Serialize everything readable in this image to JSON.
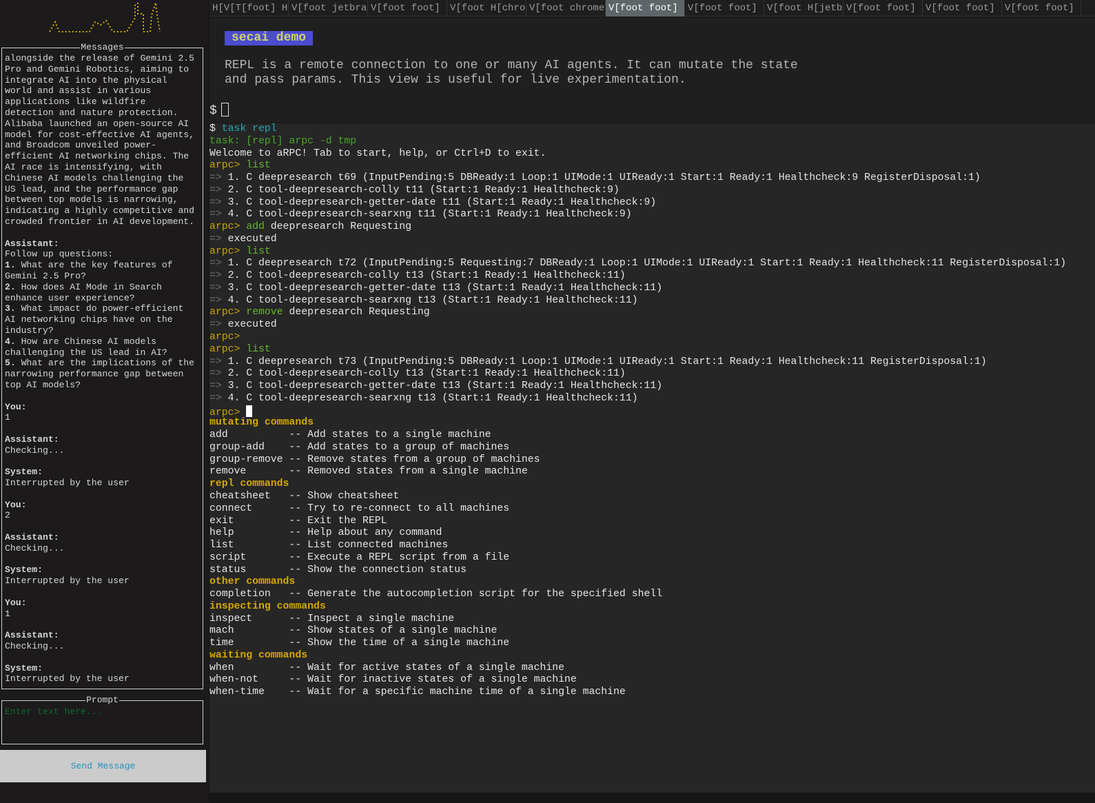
{
  "colors": {
    "accent_badge": "#4c4cd0",
    "prompt_yellow": "#c8a400",
    "command_green": "#62b82c",
    "header_yellow": "#d4a800",
    "send_text": "#2a8fc0"
  },
  "left": {
    "messages_title": "Messages",
    "messages": [
      {
        "role": "",
        "lines": [
          "alongside the release of Gemini 2.5",
          "Pro and Gemini Robotics, aiming to",
          "integrate AI into the physical",
          "world and assist in various",
          "applications like wildfire",
          "detection and nature protection.",
          "Alibaba launched an open-source AI",
          "model for cost-effective AI agents,",
          "and Broadcom unveiled power-",
          "efficient AI networking chips. The",
          "AI race is intensifying, with",
          "Chinese AI models challenging the",
          "US lead, and the performance gap",
          "between top models is narrowing,",
          "indicating a highly competitive and",
          "crowded frontier in AI development."
        ]
      },
      {
        "role": "Assistant",
        "lines": [
          "Follow up questions:",
          "1. What are the key features of",
          "Gemini 2.5 Pro?",
          "2. How does AI Mode in Search",
          "enhance user experience?",
          "3. What impact do power-efficient",
          "AI networking chips have on the",
          "industry?",
          "4. How are Chinese AI models",
          "challenging the US lead in AI?",
          "5. What are the implications of the",
          "narrowing performance gap between",
          "top AI models?"
        ]
      },
      {
        "role": "You",
        "lines": [
          "1"
        ]
      },
      {
        "role": "Assistant",
        "lines": [
          "Checking..."
        ]
      },
      {
        "role": "System",
        "lines": [
          "Interrupted by the user"
        ]
      },
      {
        "role": "You",
        "lines": [
          "2"
        ]
      },
      {
        "role": "Assistant",
        "lines": [
          "Checking..."
        ]
      },
      {
        "role": "System",
        "lines": [
          "Interrupted by the user"
        ]
      },
      {
        "role": "You",
        "lines": [
          "1"
        ]
      },
      {
        "role": "Assistant",
        "lines": [
          "Checking..."
        ]
      },
      {
        "role": "System",
        "lines": [
          "Interrupted by the user"
        ]
      }
    ],
    "prompt_title": "Prompt",
    "prompt_placeholder": "Enter text here...",
    "send_label": "Send Message"
  },
  "tabs": [
    {
      "label": "H[V[T[foot] H",
      "active": false
    },
    {
      "label": "V[foot jetbra:",
      "active": false
    },
    {
      "label": "V[foot foot]",
      "active": false
    },
    {
      "label": "V[foot H[chrom",
      "active": false
    },
    {
      "label": "V[foot chrome",
      "active": false
    },
    {
      "label": "V[foot foot]",
      "active": true
    },
    {
      "label": "V[foot foot]",
      "active": false
    },
    {
      "label": "V[foot H[jetb:",
      "active": false
    },
    {
      "label": "V[foot foot]",
      "active": false
    },
    {
      "label": "V[foot foot]",
      "active": false
    },
    {
      "label": "V[foot foot]",
      "active": false
    }
  ],
  "top": {
    "badge": "secai demo",
    "description": "REPL is a remote connection to one or many AI agents. It can mutate the state\nand pass params. This view is useful for live experimentation.",
    "shell_prompt": "$"
  },
  "terminal": [
    [
      [
        "w",
        "$ "
      ],
      [
        "c",
        "task repl"
      ]
    ],
    [
      [
        "g",
        "task: [repl] arpc -d tmp"
      ]
    ],
    [
      [
        "w",
        "Welcome to aRPC! Tab to start, help, or Ctrl+D to exit."
      ]
    ],
    [
      [
        "y",
        "arpc> "
      ],
      [
        "gl",
        "list"
      ]
    ],
    [
      [
        "d",
        "=> "
      ],
      [
        "w",
        "1. C deepresearch t69 (InputPending:5 DBReady:1 Loop:1 UIMode:1 UIReady:1 Start:1 Ready:1 Healthcheck:9 RegisterDisposal:1)"
      ]
    ],
    [
      [
        "d",
        "=> "
      ],
      [
        "w",
        "2. C tool-deepresearch-colly t11 (Start:1 Ready:1 Healthcheck:9)"
      ]
    ],
    [
      [
        "d",
        "=> "
      ],
      [
        "w",
        "3. C tool-deepresearch-getter-date t11 (Start:1 Ready:1 Healthcheck:9)"
      ]
    ],
    [
      [
        "d",
        "=> "
      ],
      [
        "w",
        "4. C tool-deepresearch-searxng t11 (Start:1 Ready:1 Healthcheck:9)"
      ]
    ],
    [
      [
        "y",
        "arpc> "
      ],
      [
        "gl",
        "add"
      ],
      [
        "w",
        " deepresearch Requesting"
      ]
    ],
    [
      [
        "d",
        "=> "
      ],
      [
        "w",
        "executed"
      ]
    ],
    [
      [
        "y",
        "arpc> "
      ],
      [
        "gl",
        "list"
      ]
    ],
    [
      [
        "d",
        "=> "
      ],
      [
        "w",
        "1. C deepresearch t72 (InputPending:5 Requesting:7 DBReady:1 Loop:1 UIMode:1 UIReady:1 Start:1 Ready:1 Healthcheck:11 RegisterDisposal:1)"
      ]
    ],
    [
      [
        "d",
        "=> "
      ],
      [
        "w",
        "2. C tool-deepresearch-colly t13 (Start:1 Ready:1 Healthcheck:11)"
      ]
    ],
    [
      [
        "d",
        "=> "
      ],
      [
        "w",
        "3. C tool-deepresearch-getter-date t13 (Start:1 Ready:1 Healthcheck:11)"
      ]
    ],
    [
      [
        "d",
        "=> "
      ],
      [
        "w",
        "4. C tool-deepresearch-searxng t13 (Start:1 Ready:1 Healthcheck:11)"
      ]
    ],
    [
      [
        "y",
        "arpc> "
      ],
      [
        "gl",
        "remove"
      ],
      [
        "w",
        " deepresearch Requesting"
      ]
    ],
    [
      [
        "d",
        "=> "
      ],
      [
        "w",
        "executed"
      ]
    ],
    [
      [
        "y",
        "arpc>"
      ]
    ],
    [
      [
        "y",
        "arpc> "
      ],
      [
        "gl",
        "list"
      ]
    ],
    [
      [
        "d",
        "=> "
      ],
      [
        "w",
        "1. C deepresearch t73 (InputPending:5 DBReady:1 Loop:1 UIMode:1 UIReady:1 Start:1 Ready:1 Healthcheck:11 RegisterDisposal:1)"
      ]
    ],
    [
      [
        "d",
        "=> "
      ],
      [
        "w",
        "2. C tool-deepresearch-colly t13 (Start:1 Ready:1 Healthcheck:11)"
      ]
    ],
    [
      [
        "d",
        "=> "
      ],
      [
        "w",
        "3. C tool-deepresearch-getter-date t13 (Start:1 Ready:1 Healthcheck:11)"
      ]
    ],
    [
      [
        "d",
        "=> "
      ],
      [
        "w",
        "4. C tool-deepresearch-searxng t13 (Start:1 Ready:1 Healthcheck:11)"
      ]
    ],
    [
      [
        "y",
        "arpc> "
      ],
      [
        "cursor",
        ""
      ]
    ],
    [
      [
        "h",
        "mutating commands"
      ]
    ],
    [
      [
        "w",
        "add          -- Add states to a single machine"
      ]
    ],
    [
      [
        "w",
        "group-add    -- Add states to a group of machines"
      ]
    ],
    [
      [
        "w",
        "group-remove -- Remove states from a group of machines"
      ]
    ],
    [
      [
        "w",
        "remove       -- Removed states from a single machine"
      ]
    ],
    [
      [
        "h",
        "repl commands"
      ]
    ],
    [
      [
        "w",
        "cheatsheet   -- Show cheatsheet"
      ]
    ],
    [
      [
        "w",
        "connect      -- Try to re-connect to all machines"
      ]
    ],
    [
      [
        "w",
        "exit         -- Exit the REPL"
      ]
    ],
    [
      [
        "w",
        "help         -- Help about any command"
      ]
    ],
    [
      [
        "w",
        "list         -- List connected machines"
      ]
    ],
    [
      [
        "w",
        "script       -- Execute a REPL script from a file"
      ]
    ],
    [
      [
        "w",
        "status       -- Show the connection status"
      ]
    ],
    [
      [
        "h",
        "other commands"
      ]
    ],
    [
      [
        "w",
        "completion   -- Generate the autocompletion script for the specified shell"
      ]
    ],
    [
      [
        "h",
        "inspecting commands"
      ]
    ],
    [
      [
        "w",
        "inspect      -- Inspect a single machine"
      ]
    ],
    [
      [
        "w",
        "mach         -- Show states of a single machine"
      ]
    ],
    [
      [
        "w",
        "time         -- Show the time of a single machine"
      ]
    ],
    [
      [
        "h",
        "waiting commands"
      ]
    ],
    [
      [
        "w",
        "when         -- Wait for active states of a single machine"
      ]
    ],
    [
      [
        "w",
        "when-not     -- Wait for inactive states of a single machine"
      ]
    ],
    [
      [
        "w",
        "when-time    -- Wait for a specific machine time of a single machine"
      ]
    ]
  ]
}
